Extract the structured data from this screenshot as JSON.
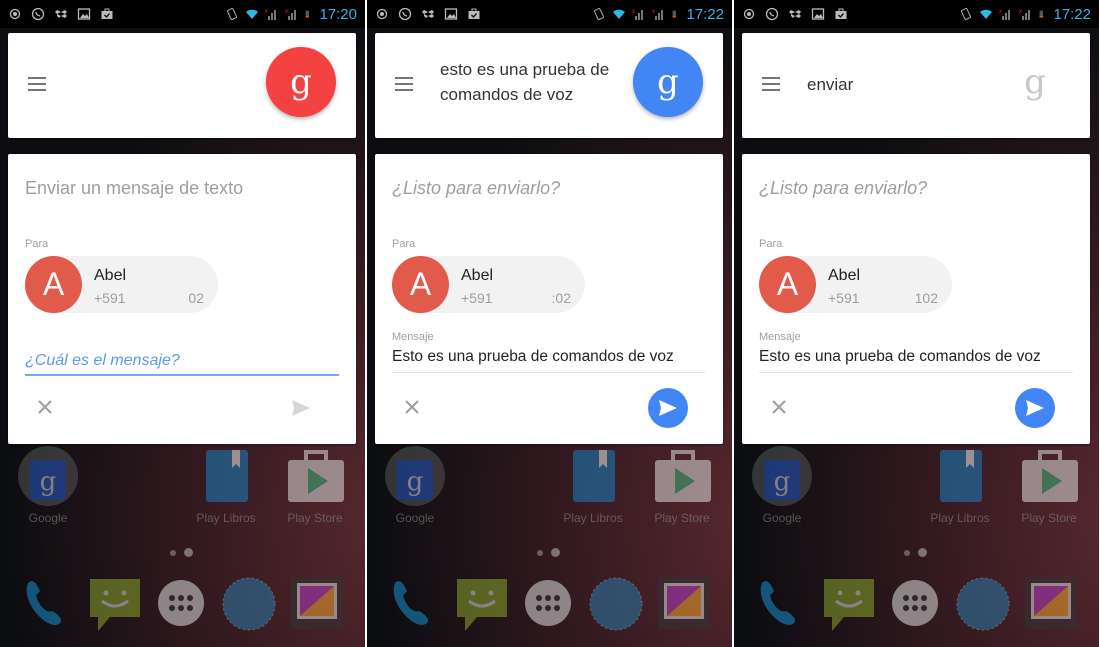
{
  "screens": [
    {
      "status": {
        "time": "17:20"
      },
      "search": {
        "query": "",
        "mic_state": "listening-red",
        "mic_glyph": "g"
      },
      "card": {
        "title": "Enviar un mensaje de texto",
        "to_label": "Para",
        "contact": {
          "initial": "A",
          "name": "Abel",
          "number_prefix": "+591",
          "number_suffix": "02"
        },
        "message_prompt": "¿Cuál es el mensaje?",
        "message_label": "",
        "message_text": "",
        "send_enabled": false
      }
    },
    {
      "status": {
        "time": "17:22"
      },
      "search": {
        "query": "esto es una prueba de comandos de voz",
        "mic_state": "listening-blue",
        "mic_glyph": "g"
      },
      "card": {
        "title": "¿Listo para enviarlo?",
        "to_label": "Para",
        "contact": {
          "initial": "A",
          "name": "Abel",
          "number_prefix": "+591",
          "number_suffix": ":02"
        },
        "message_label": "Mensaje",
        "message_text": "Esto es una prueba de comandos de voz",
        "send_enabled": true
      }
    },
    {
      "status": {
        "time": "17:22"
      },
      "search": {
        "query": "enviar",
        "mic_state": "idle",
        "mic_glyph": "g"
      },
      "card": {
        "title": "¿Listo para enviarlo?",
        "to_label": "Para",
        "contact": {
          "initial": "A",
          "name": "Abel",
          "number_prefix": "+591",
          "number_suffix": "102"
        },
        "message_label": "Mensaje",
        "message_text": "Esto es una prueba de comandos de voz",
        "send_enabled": true
      }
    }
  ],
  "home": {
    "apps": [
      {
        "label": "Google",
        "icon": "google-search-icon"
      },
      {
        "label": "Play Libros",
        "icon": "play-books-icon"
      },
      {
        "label": "Play Store",
        "icon": "play-store-icon"
      }
    ],
    "dock": [
      "phone-icon",
      "messaging-icon",
      "app-drawer-icon",
      "browser-icon",
      "gallery-icon"
    ]
  },
  "colors": {
    "mic_red": "#f44141",
    "accent_blue": "#4285f4",
    "avatar_red": "#e25a4a",
    "status_time": "#33b5e5"
  }
}
